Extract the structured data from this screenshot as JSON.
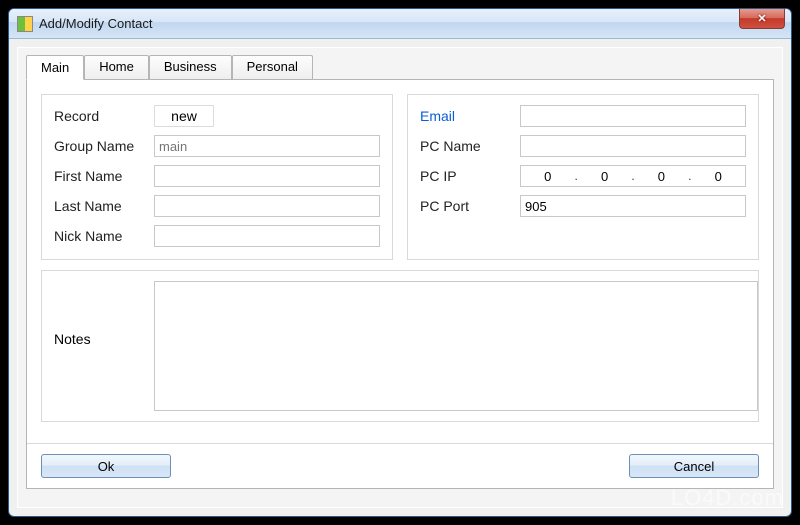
{
  "window": {
    "title": "Add/Modify Contact"
  },
  "tabs": [
    {
      "label": "Main"
    },
    {
      "label": "Home"
    },
    {
      "label": "Business"
    },
    {
      "label": "Personal"
    }
  ],
  "left": {
    "record": {
      "label": "Record",
      "value": "new"
    },
    "group": {
      "label": "Group Name",
      "placeholder": "main",
      "value": ""
    },
    "first": {
      "label": "First Name",
      "value": ""
    },
    "last": {
      "label": "Last Name",
      "value": ""
    },
    "nick": {
      "label": "Nick Name",
      "value": ""
    }
  },
  "right": {
    "email": {
      "label": "Email",
      "value": ""
    },
    "pcname": {
      "label": "PC Name",
      "value": ""
    },
    "pcip": {
      "label": "PC IP",
      "o1": "0",
      "o2": "0",
      "o3": "0",
      "o4": "0"
    },
    "pcport": {
      "label": "PC Port",
      "value": "905"
    }
  },
  "notes": {
    "label": "Notes",
    "value": ""
  },
  "buttons": {
    "ok": "Ok",
    "cancel": "Cancel"
  },
  "watermark": "LO4D.com"
}
